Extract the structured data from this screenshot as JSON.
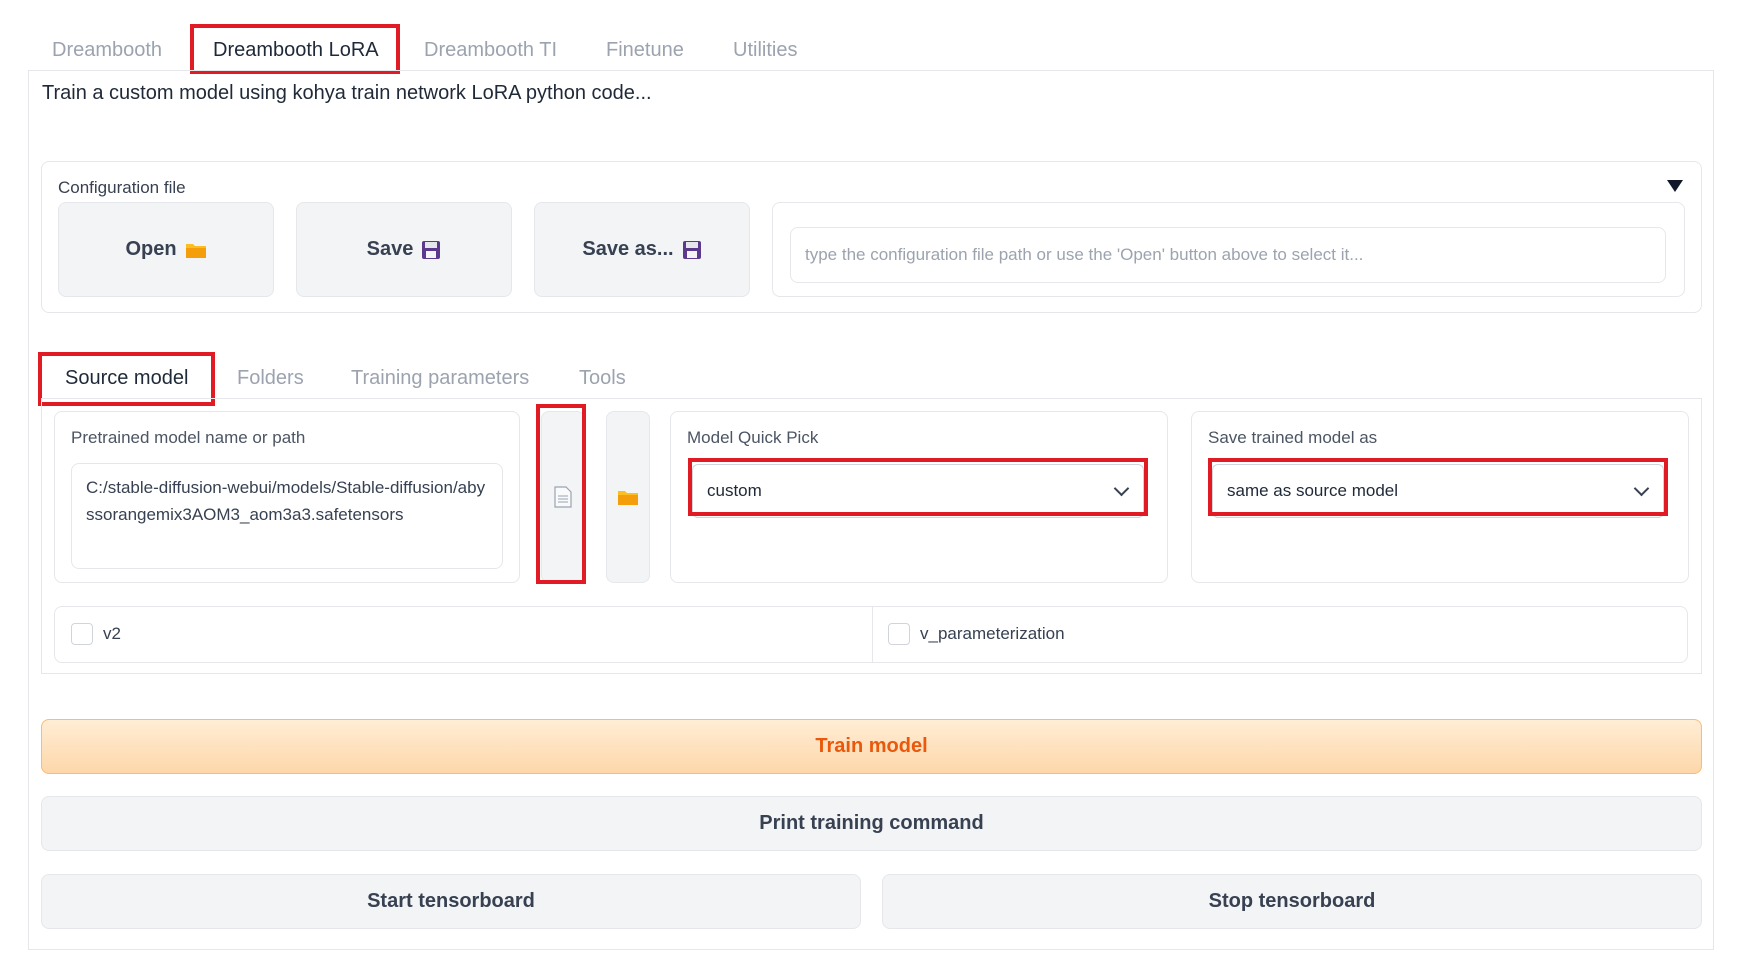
{
  "top_tabs": [
    "Dreambooth",
    "Dreambooth LoRA",
    "Dreambooth TI",
    "Finetune",
    "Utilities"
  ],
  "description": "Train a custom model using kohya train network LoRA python code...",
  "config": {
    "label": "Configuration file",
    "open_label": "Open",
    "save_label": "Save",
    "save_as_label": "Save as...",
    "path_placeholder": "type the configuration file path or use the 'Open' button above to select it..."
  },
  "sub_tabs": [
    "Source model",
    "Folders",
    "Training parameters",
    "Tools"
  ],
  "source_model": {
    "pretrained_label": "Pretrained model name or path",
    "pretrained_value": "C:/stable-diffusion-webui/models/Stable-diffusion/abyssorangemix3AOM3_aom3a3.safetensors",
    "quick_pick_label": "Model Quick Pick",
    "quick_pick_value": "custom",
    "save_as_label": "Save trained model as",
    "save_as_value": "same as source model",
    "v2_label": "v2",
    "v_param_label": "v_parameterization"
  },
  "buttons": {
    "train": "Train model",
    "print": "Print training command",
    "start_tb": "Start tensorboard",
    "stop_tb": "Stop tensorboard"
  },
  "colors": {
    "highlight": "#e01b24",
    "train_text": "#ea580c",
    "train_bg": "#fed7aa"
  }
}
